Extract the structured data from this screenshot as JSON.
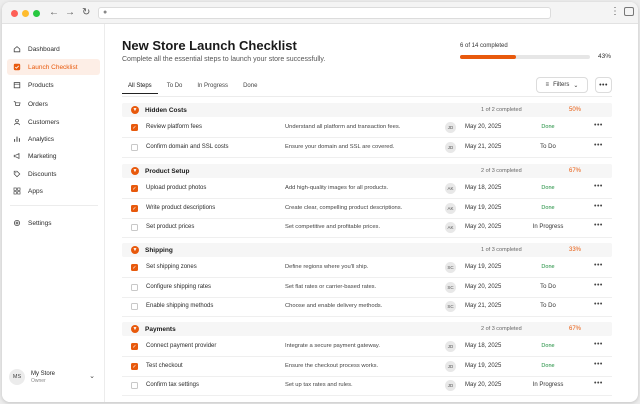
{
  "page": {
    "title": "New Store Launch Checklist",
    "subtitle": "Complete all the essential steps to launch your store successfully.",
    "progress_label": "6 of 14 completed",
    "progress_fraction": 0.43,
    "progress_percent": "43%"
  },
  "colors": {
    "accent": "#e8590c",
    "done": "#1e8e3e",
    "active_bg": "#fdeee6"
  },
  "sidebar": {
    "items": [
      {
        "label": "Dashboard",
        "icon": "home-icon"
      },
      {
        "label": "Launch Checklist",
        "icon": "checkbox-icon"
      },
      {
        "label": "Products",
        "icon": "box-icon"
      },
      {
        "label": "Orders",
        "icon": "cart-icon"
      },
      {
        "label": "Customers",
        "icon": "user-icon"
      },
      {
        "label": "Analytics",
        "icon": "chart-icon"
      },
      {
        "label": "Marketing",
        "icon": "megaphone-icon"
      },
      {
        "label": "Discounts",
        "icon": "tag-icon"
      },
      {
        "label": "Apps",
        "icon": "grid-icon"
      }
    ],
    "settings": {
      "label": "Settings",
      "icon": "gear-icon"
    },
    "store": {
      "initials": "MS",
      "name": "My Store",
      "role": "Owner"
    }
  },
  "toolbar": {
    "tabs": [
      "All Steps",
      "To Do",
      "In Progress",
      "Done"
    ],
    "filters_label": "Filters",
    "more_label": "•••"
  },
  "groups": [
    {
      "name": "Hidden Costs",
      "count": "1 of 2 completed",
      "pct": "50%",
      "rows": [
        {
          "checked": true,
          "name": "Review platform fees",
          "desc": "Understand all platform and transaction fees.",
          "who": "JD",
          "date": "May 20, 2025",
          "status": "Done"
        },
        {
          "checked": false,
          "name": "Confirm domain and SSL costs",
          "desc": "Ensure your domain and SSL are covered.",
          "who": "JD",
          "date": "May 21, 2025",
          "status": "To Do"
        }
      ]
    },
    {
      "name": "Product Setup",
      "count": "2 of 3 completed",
      "pct": "67%",
      "rows": [
        {
          "checked": true,
          "name": "Upload product photos",
          "desc": "Add high-quality images for all products.",
          "who": "AK",
          "date": "May 18, 2025",
          "status": "Done"
        },
        {
          "checked": true,
          "name": "Write product descriptions",
          "desc": "Create clear, compelling product descriptions.",
          "who": "AK",
          "date": "May 19, 2025",
          "status": "Done"
        },
        {
          "checked": false,
          "name": "Set product prices",
          "desc": "Set competitive and profitable prices.",
          "who": "AK",
          "date": "May 20, 2025",
          "status": "In Progress"
        }
      ]
    },
    {
      "name": "Shipping",
      "count": "1 of 3 completed",
      "pct": "33%",
      "rows": [
        {
          "checked": true,
          "name": "Set shipping zones",
          "desc": "Define regions where you'll ship.",
          "who": "SC",
          "date": "May 19, 2025",
          "status": "Done"
        },
        {
          "checked": false,
          "name": "Configure shipping rates",
          "desc": "Set flat rates or carrier-based rates.",
          "who": "SC",
          "date": "May 20, 2025",
          "status": "To Do"
        },
        {
          "checked": false,
          "name": "Enable shipping methods",
          "desc": "Choose and enable delivery methods.",
          "who": "SC",
          "date": "May 21, 2025",
          "status": "To Do"
        }
      ]
    },
    {
      "name": "Payments",
      "count": "2 of 3 completed",
      "pct": "67%",
      "rows": [
        {
          "checked": true,
          "name": "Connect payment provider",
          "desc": "Integrate a secure payment gateway.",
          "who": "JD",
          "date": "May 18, 2025",
          "status": "Done"
        },
        {
          "checked": true,
          "name": "Test checkout",
          "desc": "Ensure the checkout process works.",
          "who": "JD",
          "date": "May 19, 2025",
          "status": "Done"
        },
        {
          "checked": false,
          "name": "Confirm tax settings",
          "desc": "Set up tax rates and rules.",
          "who": "JD",
          "date": "May 20, 2025",
          "status": "In Progress"
        }
      ]
    }
  ]
}
